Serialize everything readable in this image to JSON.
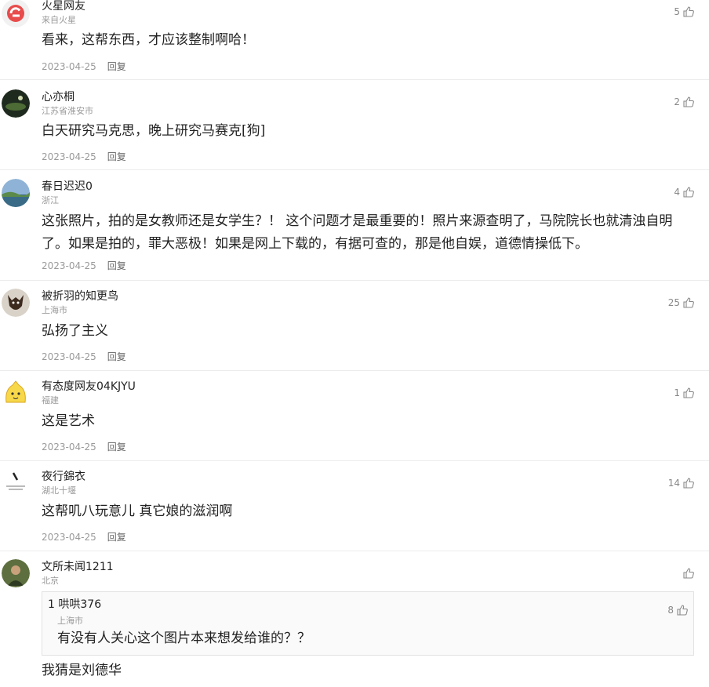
{
  "comments": [
    {
      "user": "火星网友",
      "location": "来自火星",
      "likes": "5",
      "text": "看来，这帮东西，才应该整制啊哈！",
      "date": "2023-04-25",
      "reply": "回复"
    },
    {
      "user": "心亦桐",
      "location": "江苏省淮安市",
      "likes": "2",
      "text": "白天研究马克思，晚上研究马赛克[狗]",
      "date": "2023-04-25",
      "reply": "回复"
    },
    {
      "user": "春日迟迟0",
      "location": "浙江",
      "likes": "4",
      "text": "这张照片，拍的是女教师还是女学生？！ 这个问题才是最重要的！照片来源查明了，马院院长也就清浊自明了。如果是拍的，罪大恶极！如果是网上下载的，有据可查的，那是他自娱，道德情操低下。",
      "date": "2023-04-25",
      "reply": "回复"
    },
    {
      "user": "被折羽的知更鸟",
      "location": "上海市",
      "likes": "25",
      "text": "弘扬了主义",
      "date": "2023-04-25",
      "reply": "回复"
    },
    {
      "user": "有态度网友04KJYU",
      "location": "福建",
      "likes": "1",
      "text": "这是艺术",
      "date": "2023-04-25",
      "reply": "回复"
    },
    {
      "user": "夜行錦衣",
      "location": "湖北十堰",
      "likes": "14",
      "text": "这帮叽八玩意儿 真它娘的滋润啊",
      "date": "2023-04-25",
      "reply": "回复"
    },
    {
      "user": "文所未闻1211",
      "location": "北京",
      "likes": "",
      "text": "我猜是刘德华",
      "quoted": {
        "index": "1",
        "user": "哄哄376",
        "location": "上海市",
        "likes": "8",
        "text": "有没有人关心这个图片本来想发给谁的？？"
      }
    }
  ],
  "icons": {
    "like": "thumbs-up-icon"
  },
  "colors": {
    "meta": "#9a9a9a",
    "border": "#ececec"
  }
}
